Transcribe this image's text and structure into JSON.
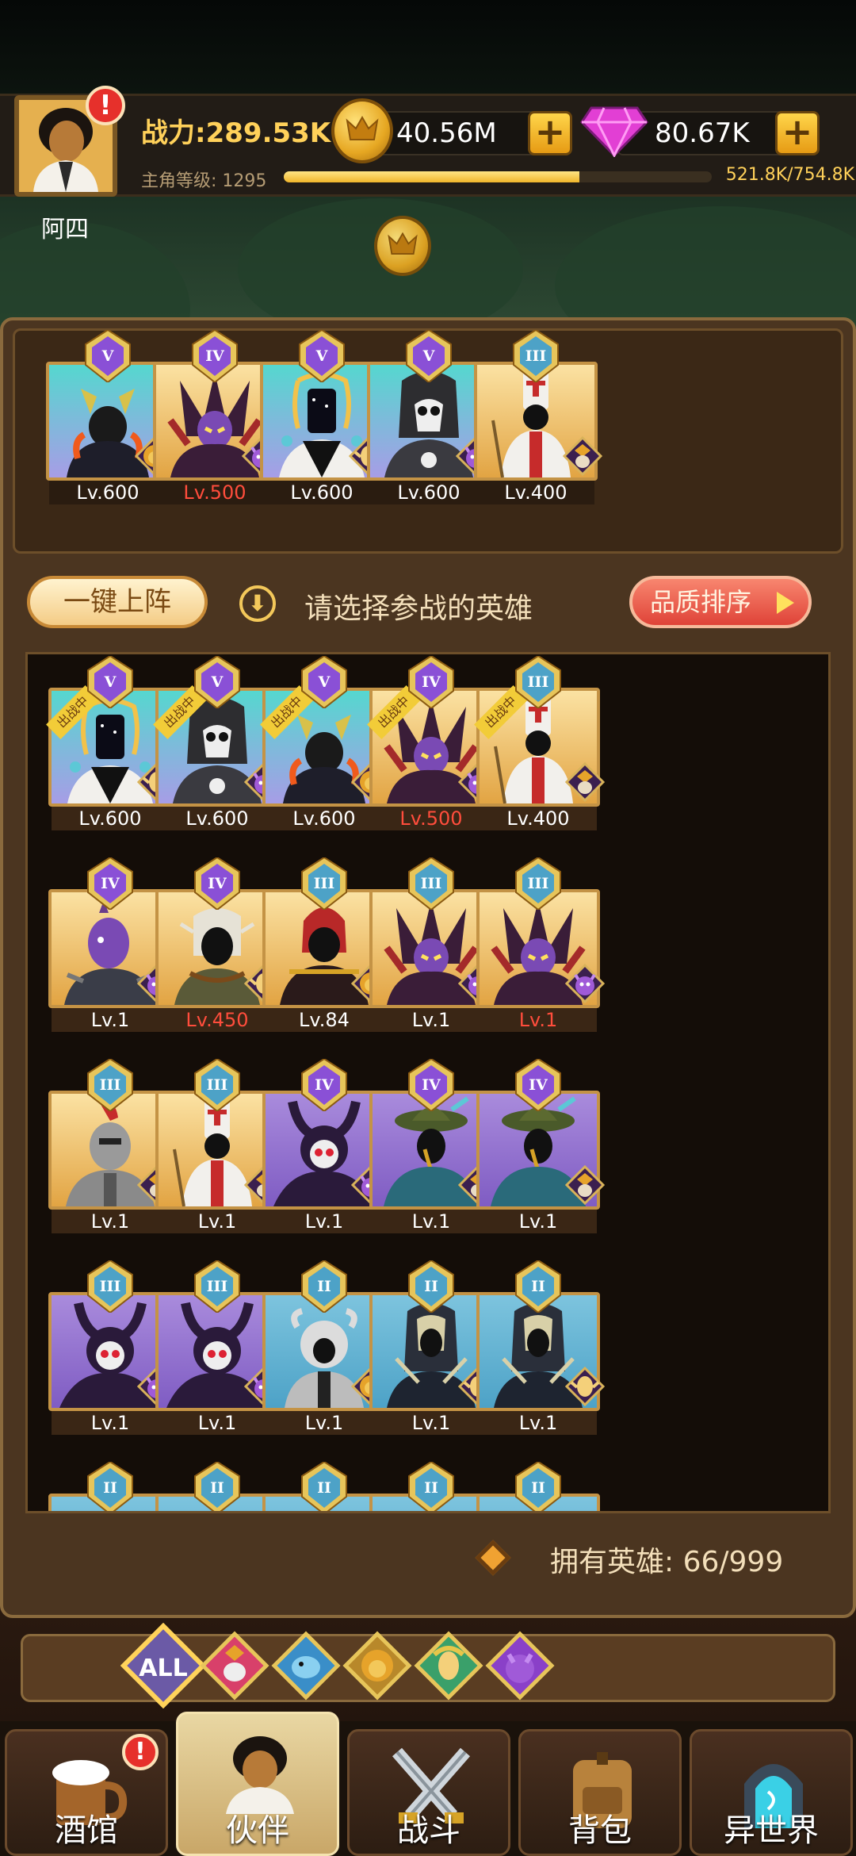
{
  "player": {
    "name": "阿四",
    "power": "战力:289.53K",
    "level_label": "主角等级:  1295",
    "xp": "521.8K/754.8K",
    "xp_fraction": 0.69
  },
  "currency": {
    "coins": "40.56M",
    "gems": "80.67K",
    "plus": "+"
  },
  "alerts": {
    "mark": "!"
  },
  "lineup_heroes": [
    {
      "rank": "V",
      "level": "Lv.600",
      "bg": "cyan",
      "hero": "horned-knight",
      "faction": "lion",
      "red": false
    },
    {
      "rank": "IV",
      "level": "Lv.500",
      "bg": "gold",
      "hero": "spike-demon",
      "faction": "demon",
      "red": true
    },
    {
      "rank": "V",
      "level": "Lv.600",
      "bg": "cyan",
      "hero": "void-mage",
      "faction": "elf",
      "red": false
    },
    {
      "rank": "V",
      "level": "Lv.600",
      "bg": "cyan",
      "hero": "reaper",
      "faction": "demon",
      "red": false
    },
    {
      "rank": "III",
      "level": "Lv.400",
      "bg": "gold",
      "hero": "priest",
      "faction": "angel",
      "red": false
    }
  ],
  "controls": {
    "auto_deploy": "一键上阵",
    "down_arrow": "⬇",
    "prompt": "请选择参战的英雄",
    "sort": "品质排序"
  },
  "deployed_label": "出战中",
  "roster": [
    {
      "rank": "V",
      "level": "Lv.600",
      "bg": "cyan",
      "hero": "void-mage",
      "faction": "elf",
      "red": false,
      "deployed": true
    },
    {
      "rank": "V",
      "level": "Lv.600",
      "bg": "cyan",
      "hero": "reaper",
      "faction": "demon",
      "red": false,
      "deployed": true
    },
    {
      "rank": "V",
      "level": "Lv.600",
      "bg": "cyan",
      "hero": "horned-knight",
      "faction": "lion",
      "red": false,
      "deployed": true
    },
    {
      "rank": "IV",
      "level": "Lv.500",
      "bg": "gold",
      "hero": "spike-demon",
      "faction": "demon",
      "red": true,
      "deployed": true
    },
    {
      "rank": "III",
      "level": "Lv.400",
      "bg": "gold",
      "hero": "priest",
      "faction": "angel",
      "red": false,
      "deployed": true
    },
    {
      "rank": "IV",
      "level": "Lv.1",
      "bg": "gold",
      "hero": "purple-ogre",
      "faction": "demon",
      "red": false,
      "deployed": false
    },
    {
      "rank": "IV",
      "level": "Lv.450",
      "bg": "gold",
      "hero": "elf-ranger",
      "faction": "elf",
      "red": true,
      "deployed": false
    },
    {
      "rank": "III",
      "level": "Lv.84",
      "bg": "gold",
      "hero": "red-lord",
      "faction": "lion",
      "red": false,
      "deployed": false
    },
    {
      "rank": "III",
      "level": "Lv.1",
      "bg": "gold",
      "hero": "spike-demon",
      "faction": "demon",
      "red": false,
      "deployed": false
    },
    {
      "rank": "III",
      "level": "Lv.1",
      "bg": "gold",
      "hero": "spike-demon",
      "faction": "demon",
      "red": true,
      "deployed": false
    },
    {
      "rank": "III",
      "level": "Lv.1",
      "bg": "gold",
      "hero": "iron-knight",
      "faction": "angel",
      "red": false,
      "deployed": false
    },
    {
      "rank": "III",
      "level": "Lv.1",
      "bg": "gold",
      "hero": "priest",
      "faction": "angel",
      "red": false,
      "deployed": false
    },
    {
      "rank": "IV",
      "level": "Lv.1",
      "bg": "purple",
      "hero": "skull-horn",
      "faction": "demon",
      "red": false,
      "deployed": false
    },
    {
      "rank": "IV",
      "level": "Lv.1",
      "bg": "purple",
      "hero": "plague-hat",
      "faction": "angel",
      "red": false,
      "deployed": false
    },
    {
      "rank": "IV",
      "level": "Lv.1",
      "bg": "purple",
      "hero": "plague-hat",
      "faction": "angel",
      "red": false,
      "deployed": false
    },
    {
      "rank": "III",
      "level": "Lv.1",
      "bg": "purple",
      "hero": "skull-horn",
      "faction": "demon",
      "red": false,
      "deployed": false
    },
    {
      "rank": "III",
      "level": "Lv.1",
      "bg": "purple",
      "hero": "skull-horn",
      "faction": "demon",
      "red": false,
      "deployed": false
    },
    {
      "rank": "II",
      "level": "Lv.1",
      "bg": "blue",
      "hero": "white-beast",
      "faction": "lion",
      "red": false,
      "deployed": false
    },
    {
      "rank": "II",
      "level": "Lv.1",
      "bg": "blue",
      "hero": "dark-elf",
      "faction": "elf",
      "red": false,
      "deployed": false
    },
    {
      "rank": "II",
      "level": "Lv.1",
      "bg": "blue",
      "hero": "dark-elf",
      "faction": "elf",
      "red": false,
      "deployed": false
    },
    {
      "rank": "II",
      "level": "",
      "bg": "blue",
      "hero": "none",
      "faction": "none",
      "red": false,
      "deployed": false
    },
    {
      "rank": "II",
      "level": "",
      "bg": "blue",
      "hero": "none",
      "faction": "none",
      "red": false,
      "deployed": false
    },
    {
      "rank": "II",
      "level": "",
      "bg": "blue",
      "hero": "none",
      "faction": "none",
      "red": false,
      "deployed": false
    },
    {
      "rank": "II",
      "level": "",
      "bg": "blue",
      "hero": "none",
      "faction": "none",
      "red": false,
      "deployed": false
    },
    {
      "rank": "II",
      "level": "",
      "bg": "blue",
      "hero": "none",
      "faction": "none",
      "red": false,
      "deployed": false
    }
  ],
  "owned": "拥有英雄:  66/999",
  "filters": {
    "all": "ALL",
    "items": [
      "angel-icon",
      "fish-icon",
      "lion-icon",
      "elf-icon",
      "demon-icon"
    ]
  },
  "nav": [
    {
      "label": "酒馆",
      "icon": "beer-mug-icon"
    },
    {
      "label": "伙伴",
      "icon": "partner-icon"
    },
    {
      "label": "战斗",
      "icon": "crossed-swords-icon"
    },
    {
      "label": "背包",
      "icon": "backpack-icon"
    },
    {
      "label": "异世界",
      "icon": "portal-icon"
    }
  ],
  "colors": {
    "cyan": [
      "#55d7cf",
      "#a79de6"
    ],
    "gold": [
      "#fbe2a3",
      "#e2a443"
    ],
    "purple": [
      "#a98bdc",
      "#7f5cc3"
    ],
    "blue": [
      "#7dc4de",
      "#4da2c7"
    ],
    "rank_frame": "#8a50d6",
    "red_level": "#ff4d3c"
  }
}
